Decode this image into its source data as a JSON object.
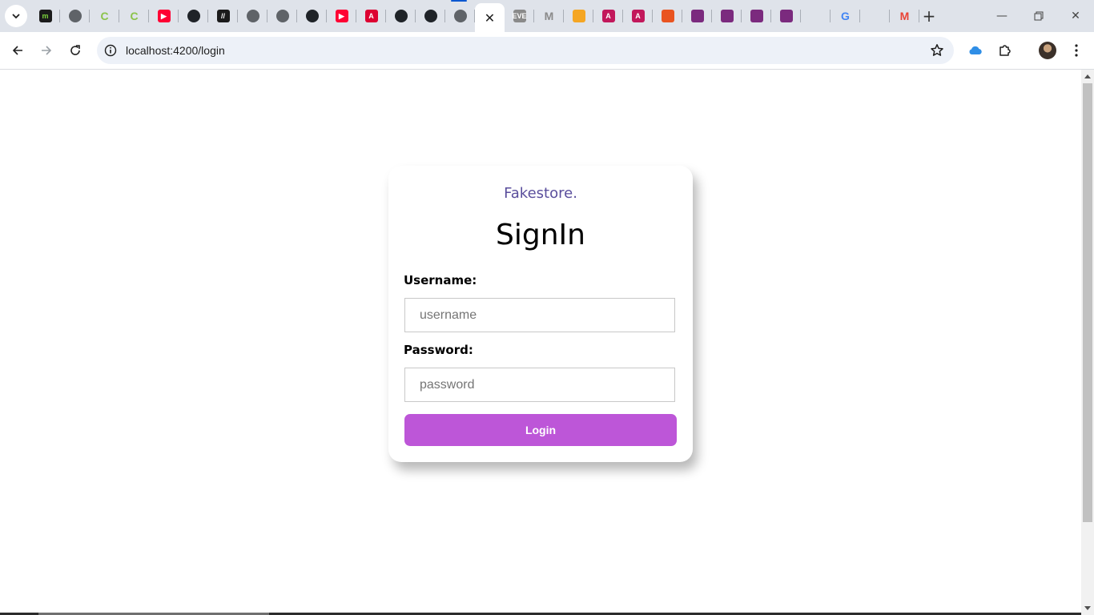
{
  "browser": {
    "tabs": [
      {
        "icon": "m-icon",
        "glyph": "m",
        "bg": "#1b1b1b",
        "fg": "#7bd23c"
      },
      {
        "icon": "globe-icon",
        "glyph": "",
        "bg": "#5f6368",
        "fg": "#fff"
      },
      {
        "icon": "c-icon",
        "glyph": "C",
        "bg": "transparent",
        "fg": "#8bc34a"
      },
      {
        "icon": "c-icon",
        "glyph": "C",
        "bg": "transparent",
        "fg": "#8bc34a"
      },
      {
        "icon": "youtube-icon",
        "glyph": "▶",
        "bg": "#ff0033",
        "fg": "#fff"
      },
      {
        "icon": "github-icon",
        "glyph": "",
        "bg": "#1f2328",
        "fg": "#fff"
      },
      {
        "icon": "slash-icon",
        "glyph": "//",
        "bg": "#1b1b1b",
        "fg": "#fff"
      },
      {
        "icon": "globe-icon",
        "glyph": "",
        "bg": "#5f6368",
        "fg": "#fff"
      },
      {
        "icon": "globe-icon",
        "glyph": "",
        "bg": "#5f6368",
        "fg": "#fff"
      },
      {
        "icon": "github-icon",
        "glyph": "",
        "bg": "#1f2328",
        "fg": "#fff"
      },
      {
        "icon": "youtube-icon",
        "glyph": "▶",
        "bg": "#ff0033",
        "fg": "#fff"
      },
      {
        "icon": "angular-icon",
        "glyph": "A",
        "bg": "#dd0031",
        "fg": "#fff"
      },
      {
        "icon": "github-icon",
        "glyph": "",
        "bg": "#1f2328",
        "fg": "#fff"
      },
      {
        "icon": "github-icon",
        "glyph": "",
        "bg": "#1f2328",
        "fg": "#fff"
      },
      {
        "icon": "globe-icon",
        "glyph": "",
        "bg": "#5f6368",
        "fg": "#fff"
      },
      {
        "icon": "close-icon",
        "glyph": "✕",
        "active": true
      },
      {
        "icon": "eve-icon",
        "glyph": "EVE",
        "bg": "#8a8a8a",
        "fg": "#fff"
      },
      {
        "icon": "m-gray-icon",
        "glyph": "M",
        "bg": "transparent",
        "fg": "#8a8a8a"
      },
      {
        "icon": "shield-icon",
        "glyph": "",
        "bg": "#f5a623",
        "fg": "#fff"
      },
      {
        "icon": "angular-icon",
        "glyph": "A",
        "bg": "#c2185b",
        "fg": "#fff"
      },
      {
        "icon": "angular-icon",
        "glyph": "A",
        "bg": "#c2185b",
        "fg": "#fff"
      },
      {
        "icon": "ubuntu-icon",
        "glyph": "",
        "bg": "#e95420",
        "fg": "#fff"
      },
      {
        "icon": "box-icon",
        "glyph": "",
        "bg": "#7b2a7e",
        "fg": "#fff"
      },
      {
        "icon": "box-icon",
        "glyph": "",
        "bg": "#7b2a7e",
        "fg": "#fff"
      },
      {
        "icon": "box-icon",
        "glyph": "",
        "bg": "#7b2a7e",
        "fg": "#fff"
      },
      {
        "icon": "box-icon",
        "glyph": "",
        "bg": "#7b2a7e",
        "fg": "#fff"
      },
      {
        "icon": "stackoverflow-icon",
        "glyph": "",
        "bg": "transparent",
        "fg": "#f48024"
      },
      {
        "icon": "google-icon",
        "glyph": "G",
        "bg": "transparent",
        "fg": "#4285f4"
      },
      {
        "icon": "mountain-icon",
        "glyph": "",
        "bg": "transparent",
        "fg": "#26a69a"
      },
      {
        "icon": "gmail-icon",
        "glyph": "M",
        "bg": "transparent",
        "fg": "#ea4335"
      }
    ],
    "url": "localhost:4200/login"
  },
  "login": {
    "brand": "Fakestore.",
    "title": "SignIn",
    "username_label": "Username:",
    "username_placeholder": "username",
    "password_label": "Password:",
    "password_placeholder": "password",
    "button_label": "Login"
  },
  "colors": {
    "brand": "#5a4e9c",
    "button": "#bd56d8"
  }
}
